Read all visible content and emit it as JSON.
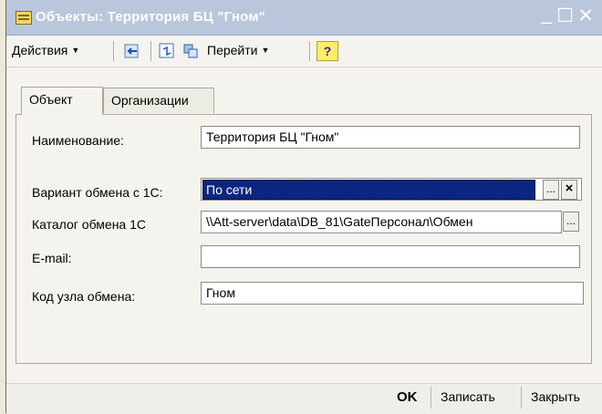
{
  "window": {
    "title": "Объекты: Территория БЦ \"Гном\"",
    "controls": {
      "minimize": "_",
      "maximize": "☐",
      "close": "✕"
    }
  },
  "toolbar": {
    "actions_label": "Действия",
    "goto_label": "Перейти",
    "help_label": "?"
  },
  "tabs": [
    {
      "label": "Объект",
      "active": true
    },
    {
      "label": "Организации",
      "active": false
    }
  ],
  "form": {
    "name": {
      "label": "Наименование:",
      "value": "Территория БЦ \"Гном\""
    },
    "exchange_variant": {
      "label": "Вариант обмена с 1С:",
      "value": "По сети"
    },
    "exchange_catalog": {
      "label": "Каталог обмена 1С",
      "value": "\\\\Att-server\\data\\DB_81\\GateПерсонал\\Обмен"
    },
    "email": {
      "label": "E-mail:",
      "value": ""
    },
    "node_code": {
      "label": "Код узла обмена:",
      "value": "Гном"
    }
  },
  "footer": {
    "ok": "OK",
    "save": "Записать",
    "close": "Закрыть"
  },
  "buttons": {
    "ellipsis": "...",
    "clear": "×"
  }
}
